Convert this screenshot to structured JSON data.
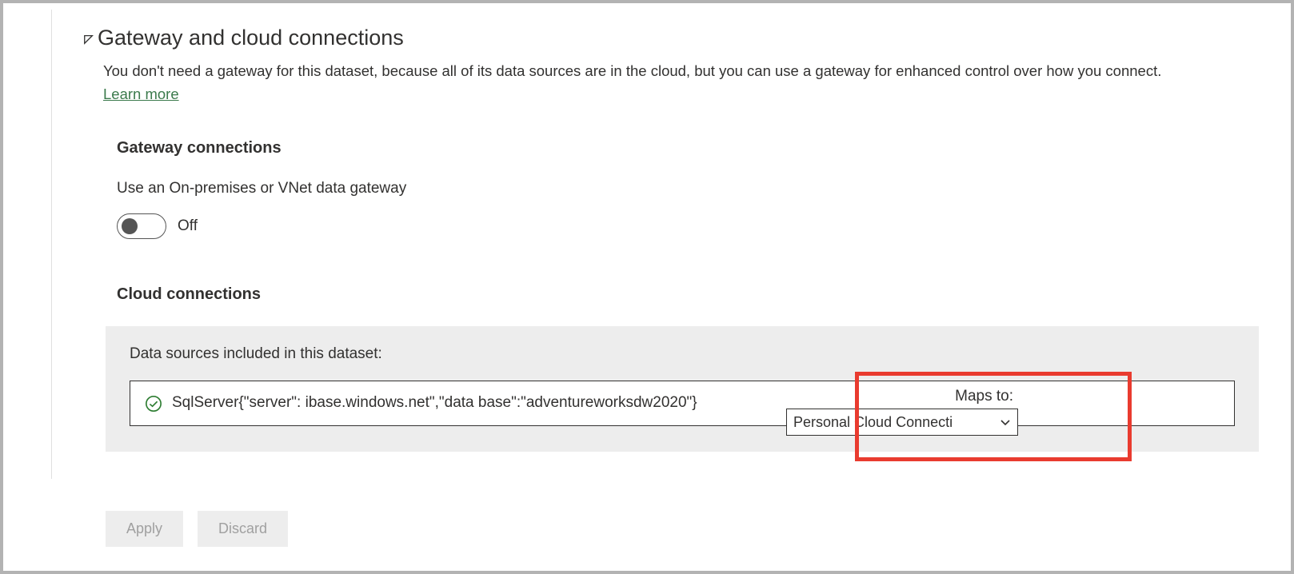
{
  "section": {
    "title": "Gateway and cloud connections",
    "description_part1": "You don't need a gateway for this dataset, because all of its data sources are in the cloud, but you can use a gateway for enhanced control over how you connect. ",
    "learn_more": "Learn more"
  },
  "gateway": {
    "title": "Gateway connections",
    "label": "Use an On-premises or VNet data gateway",
    "toggle_state": "Off",
    "toggle_on": false
  },
  "cloud": {
    "title": "Cloud connections",
    "panel_label": "Data sources included in this dataset:",
    "datasources": [
      {
        "status": "ok",
        "text": "SqlServer{\"server\":                          ibase.windows.net\",\"data base\":\"adventureworksdw2020\"}",
        "maps_to_label": "Maps to:",
        "maps_to_value": "Personal Cloud Connecti"
      }
    ]
  },
  "actions": {
    "apply": "Apply",
    "discard": "Discard"
  }
}
